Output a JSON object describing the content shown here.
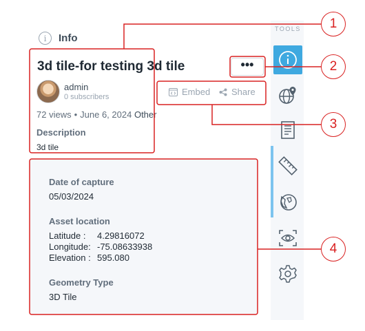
{
  "header": {
    "label": "Info",
    "icon": "info-icon"
  },
  "asset": {
    "title": "3d tile-for testing 3d tile",
    "owner": {
      "name": "admin",
      "subscribers": "0 subscribers"
    },
    "views": "72 views",
    "date": "June 6, 2024",
    "category": "Other",
    "description_label": "Description",
    "description": "3d tile"
  },
  "actions": {
    "more": "•••",
    "embed": "Embed",
    "share": "Share"
  },
  "details": {
    "capture_label": "Date of capture",
    "capture_value": "05/03/2024",
    "location_label": "Asset location",
    "latitude_key": "Latitude :",
    "latitude": "4.29816072",
    "longitude_key": "Longitude:",
    "longitude": "-75.08633938",
    "elevation_key": "Elevation :",
    "elevation": "595.080",
    "geometry_label": "Geometry Type",
    "geometry_value": "3D Tile"
  },
  "toolbar": {
    "label": "TOOLS",
    "items": [
      {
        "icon": "info-icon",
        "active": true
      },
      {
        "icon": "globe-pin-icon",
        "active": false
      },
      {
        "icon": "document-icon",
        "active": false
      },
      {
        "icon": "ruler-icon",
        "active": false
      },
      {
        "icon": "terrain-globe-icon",
        "active": false
      },
      {
        "icon": "eye-scan-icon",
        "active": false
      },
      {
        "icon": "gear-icon",
        "active": false
      }
    ]
  },
  "annotations": [
    "1",
    "2",
    "3",
    "4"
  ],
  "colors": {
    "accent": "#3fa9e0",
    "annotation": "#d92020"
  }
}
